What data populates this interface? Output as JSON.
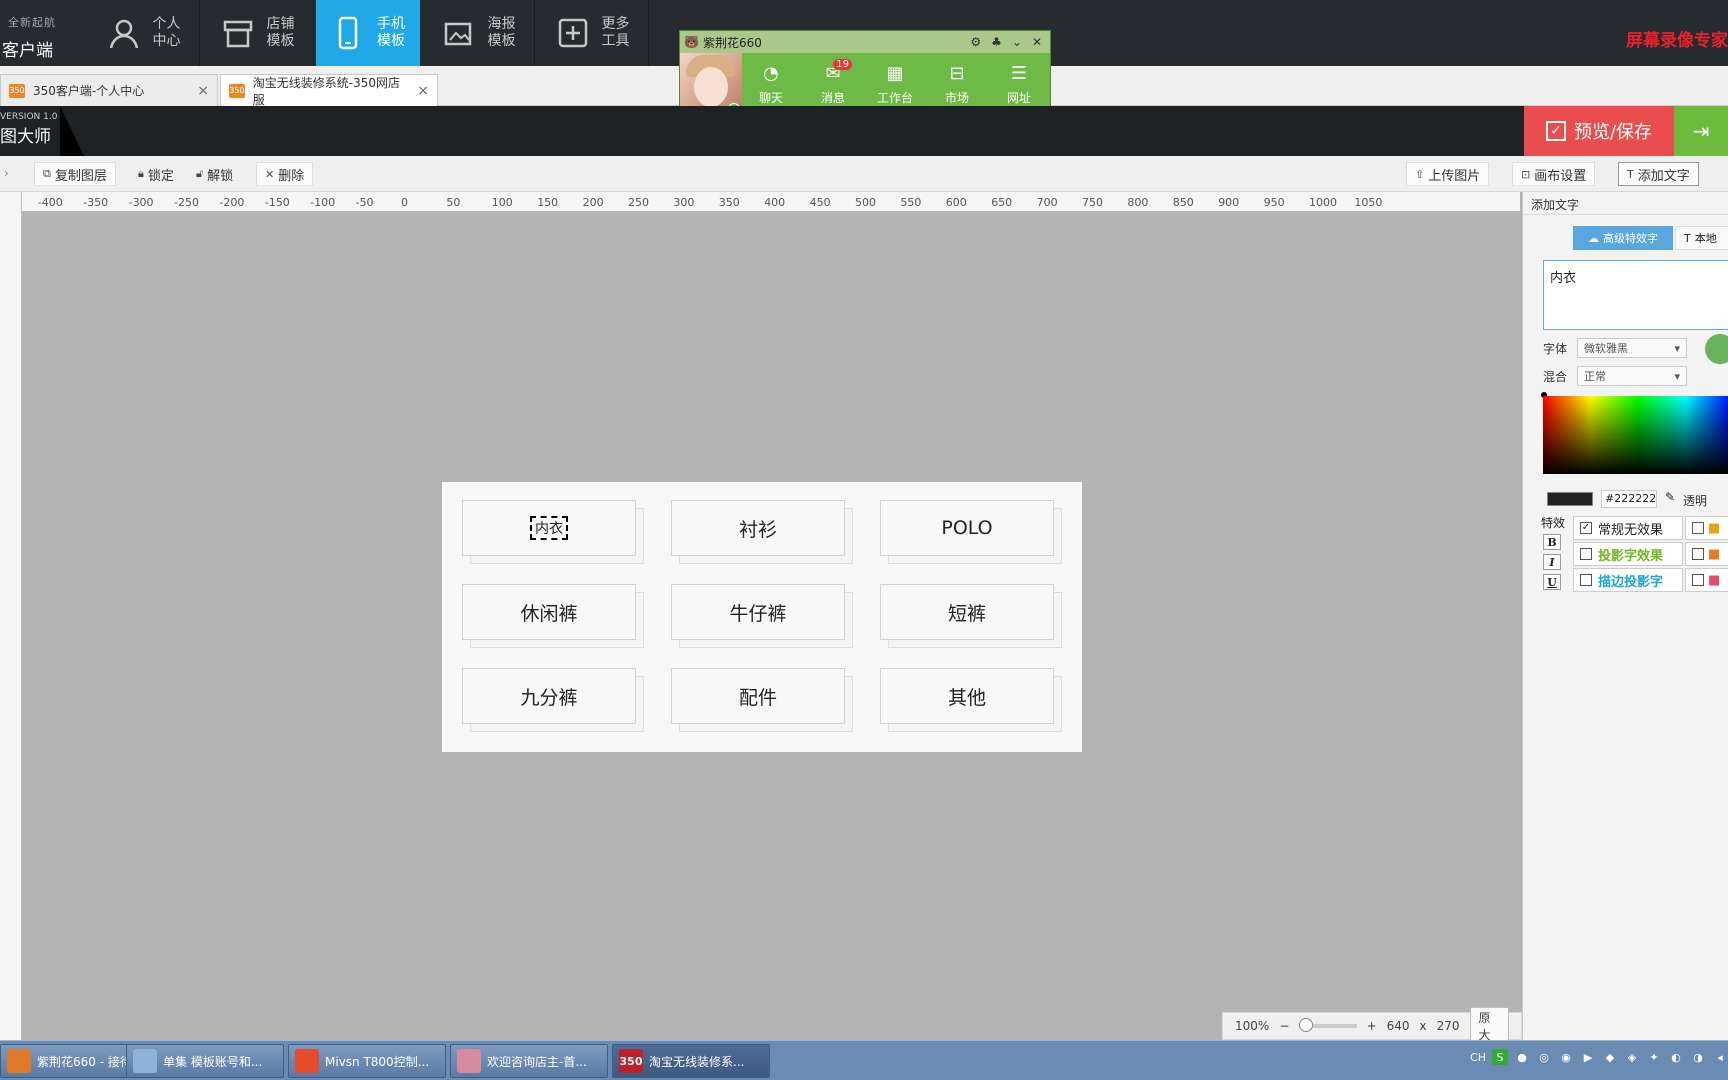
{
  "app": {
    "logo_small": "全新起航",
    "logo_big": "客户端",
    "nav": [
      {
        "label": "个人\n中心",
        "icon": "user-icon"
      },
      {
        "label": "店铺\n模板",
        "icon": "store-icon"
      },
      {
        "label": "手机\n模板",
        "icon": "phone-icon",
        "active": true
      },
      {
        "label": "海报\n模板",
        "icon": "image-icon"
      },
      {
        "label": "更多\n工具",
        "icon": "plus-box-icon"
      }
    ],
    "recorder": "屏幕录像专家"
  },
  "tabs": [
    {
      "label": "350客户端-个人中心"
    },
    {
      "label": "淘宝无线装修系统-350网店服"
    }
  ],
  "editor": {
    "version": "VERSION 1.0",
    "name": "图大师",
    "preview_save": "预览/保存"
  },
  "toolbar": {
    "copy_layer": "复制图层",
    "lock": "锁定",
    "unlock": "解锁",
    "delete": "删除",
    "upload": "上传图片",
    "canvas_settings": "画布设置",
    "add_text": "添加文字"
  },
  "ruler_ticks": [
    "-400",
    "-350",
    "-300",
    "-250",
    "-200",
    "-150",
    "-100",
    "-50",
    "0",
    "50",
    "100",
    "150",
    "200",
    "250",
    "300",
    "350",
    "400",
    "450",
    "500",
    "550",
    "600",
    "650",
    "700",
    "750",
    "800",
    "850",
    "900",
    "950",
    "1000",
    "1050"
  ],
  "board": {
    "cells": [
      "内衣",
      "衬衫",
      "POLO",
      "休闲裤",
      "牛仔裤",
      "短裤",
      "九分裤",
      "配件",
      "其他"
    ]
  },
  "zoom": {
    "percent": "100%",
    "width": "640",
    "x": "x",
    "height": "270",
    "original": "原大"
  },
  "panel": {
    "title": "添加文字",
    "tab_advanced": "高级特效字",
    "tab_local": "本地",
    "text_value": "内衣",
    "font_label": "字体",
    "font_value": "微软雅黑",
    "blend_label": "混合",
    "blend_value": "正常",
    "hex": "#222222",
    "transparent": "透明",
    "fx_label": "特效",
    "fx": [
      {
        "label": "常规无效果",
        "checked": true,
        "color": "#222222"
      },
      {
        "label": "投影字效果",
        "checked": false,
        "color": "#6fb822"
      },
      {
        "label": "描边投影字",
        "checked": false,
        "color": "#1aa6d6"
      }
    ]
  },
  "qq": {
    "title": "紫荆花660",
    "items": [
      {
        "label": "聊天",
        "icon": "chat-icon"
      },
      {
        "label": "消息",
        "icon": "mail-icon",
        "badge": "19"
      },
      {
        "label": "工作台",
        "icon": "grid-icon"
      },
      {
        "label": "市场",
        "icon": "market-icon"
      },
      {
        "label": "网址",
        "icon": "list-icon"
      }
    ]
  },
  "taskbar": {
    "items": [
      {
        "label": "紫荆花660 - 接待...",
        "color": "#e07a2a"
      },
      {
        "label": "单集 模板账号和...",
        "color": "#8fb3d8"
      },
      {
        "label": "Mivsn T800控制...",
        "color": "#e64b2b"
      },
      {
        "label": "欢迎咨询店主-首...",
        "color": "#d88aa0"
      },
      {
        "label": "淘宝无线装修系...",
        "color": "#c2202a",
        "icon_text": "350",
        "active": true
      }
    ],
    "lang": "CH"
  }
}
